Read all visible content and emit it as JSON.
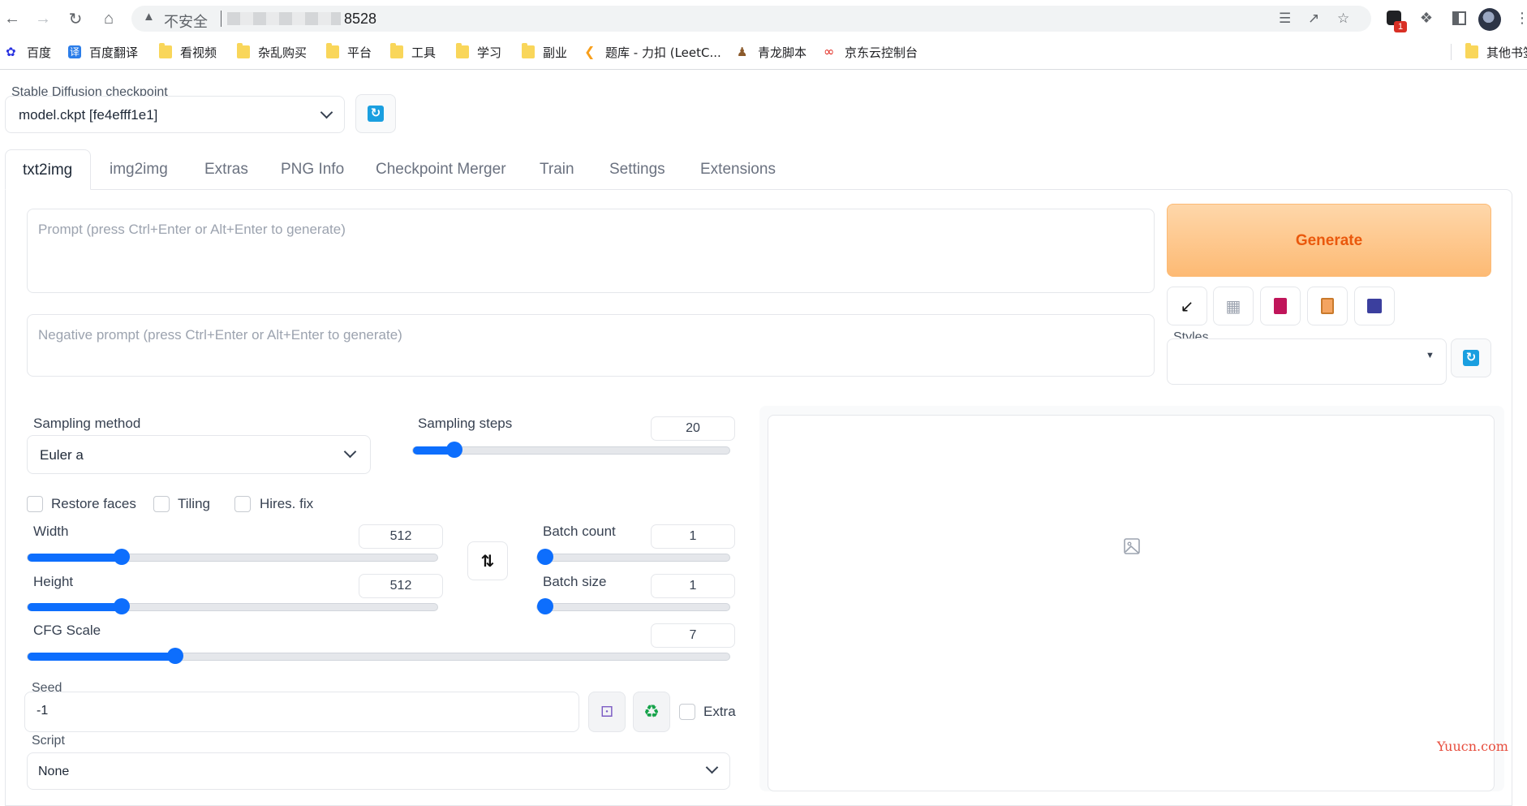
{
  "browser": {
    "insecure_label": "不安全",
    "url_port": "8528",
    "bookmarks": [
      {
        "label": "百度",
        "icon": "baidu-icon"
      },
      {
        "label": "百度翻译",
        "icon": "translate-icon"
      },
      {
        "label": "看视频",
        "icon": "folder-icon"
      },
      {
        "label": "杂乱购买",
        "icon": "folder-icon"
      },
      {
        "label": "平台",
        "icon": "folder-icon"
      },
      {
        "label": "工具",
        "icon": "folder-icon"
      },
      {
        "label": "学习",
        "icon": "folder-icon"
      },
      {
        "label": "副业",
        "icon": "folder-icon"
      },
      {
        "label": "题库 - 力扣 (LeetC...",
        "icon": "leetcode-icon"
      },
      {
        "label": "青龙脚本",
        "icon": "qinglong-icon"
      },
      {
        "label": "京东云控制台",
        "icon": "jdcloud-icon"
      },
      {
        "label": "其他书签",
        "icon": "folder-icon"
      }
    ],
    "extension_badge": "1"
  },
  "checkpoint": {
    "label": "Stable Diffusion checkpoint",
    "value": "model.ckpt [fe4efff1e1]"
  },
  "tabs": [
    "txt2img",
    "img2img",
    "Extras",
    "PNG Info",
    "Checkpoint Merger",
    "Train",
    "Settings",
    "Extensions"
  ],
  "active_tab": "txt2img",
  "prompt": {
    "placeholder": "Prompt (press Ctrl+Enter or Alt+Enter to generate)"
  },
  "negative_prompt": {
    "placeholder": "Negative prompt (press Ctrl+Enter or Alt+Enter to generate)"
  },
  "generate_label": "Generate",
  "styles_label": "Styles",
  "sampling": {
    "method_label": "Sampling method",
    "method_value": "Euler a",
    "steps_label": "Sampling steps",
    "steps_value": "20",
    "steps_fraction": 0.13
  },
  "checkboxes": [
    {
      "label": "Restore faces",
      "checked": false
    },
    {
      "label": "Tiling",
      "checked": false
    },
    {
      "label": "Hires. fix",
      "checked": false
    }
  ],
  "width": {
    "label": "Width",
    "value": "512",
    "fraction": 0.23
  },
  "height": {
    "label": "Height",
    "value": "512",
    "fraction": 0.23
  },
  "batch_count": {
    "label": "Batch count",
    "value": "1",
    "fraction": 0.0
  },
  "batch_size": {
    "label": "Batch size",
    "value": "1",
    "fraction": 0.0
  },
  "cfg": {
    "label": "CFG Scale",
    "value": "7",
    "fraction": 0.21
  },
  "seed": {
    "label": "Seed",
    "value": "-1",
    "extra_label": "Extra"
  },
  "script": {
    "label": "Script",
    "value": "None"
  },
  "watermark": "Yuucn.com",
  "colors": {
    "accent": "#0d6efd",
    "generate_bg": "#fdba74",
    "generate_text": "#ea580c"
  }
}
